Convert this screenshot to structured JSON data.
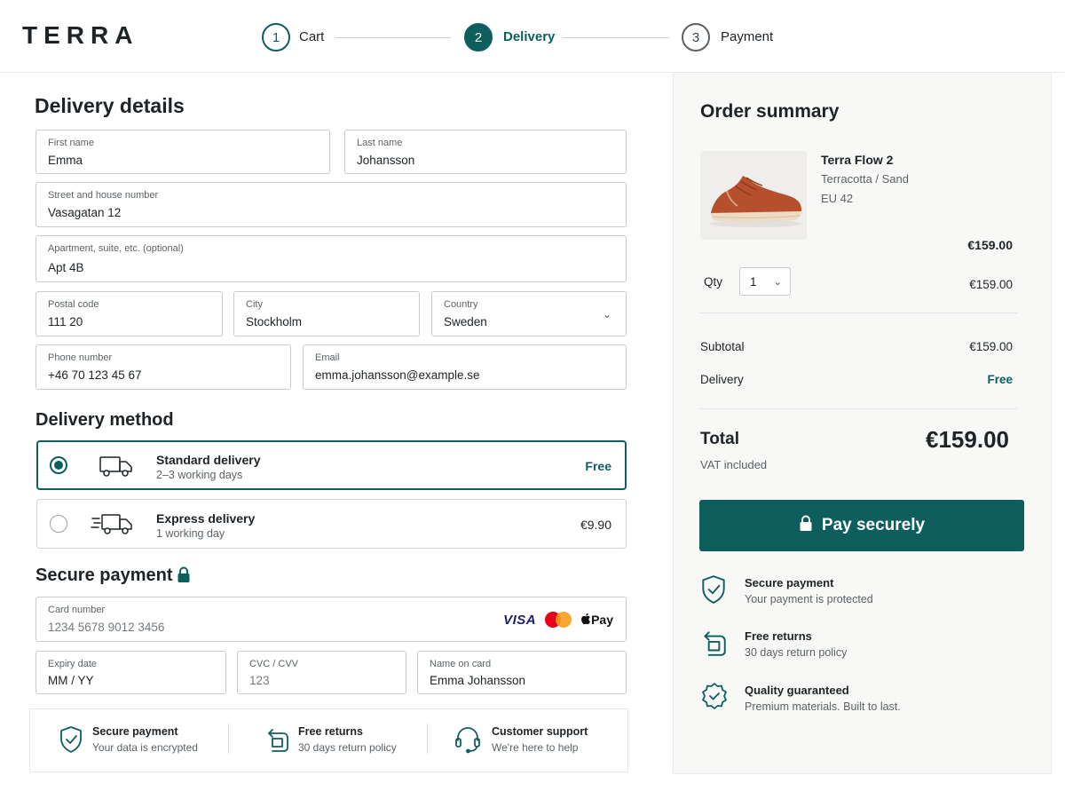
{
  "brand": {
    "logo": "TERRA"
  },
  "steps": [
    {
      "number": "1",
      "label": "Cart"
    },
    {
      "number": "2",
      "label": "Delivery"
    },
    {
      "number": "3",
      "label": "Payment"
    }
  ],
  "delivery_details": {
    "heading": "Delivery details",
    "fields": {
      "first_name": {
        "label": "First name",
        "value": "Emma"
      },
      "last_name": {
        "label": "Last name",
        "value": "Johansson"
      },
      "street": {
        "label": "Street and house number",
        "value": "Vasagatan 12"
      },
      "apartment": {
        "label": "Apartment, suite, etc. (optional)",
        "value": "Apt 4B"
      },
      "postal_code": {
        "label": "Postal code",
        "value": "111 20"
      },
      "city": {
        "label": "City",
        "value": "Stockholm"
      },
      "country": {
        "label": "Country",
        "value": "Sweden"
      },
      "phone": {
        "label": "Phone number",
        "value": "+46 70 123 45 67"
      },
      "email": {
        "label": "Email",
        "value": "emma.johansson@example.se"
      }
    }
  },
  "delivery_method": {
    "heading": "Delivery method",
    "options": [
      {
        "title": "Standard delivery",
        "subtitle": "2–3 working days",
        "price": "Free",
        "selected": true
      },
      {
        "title": "Express delivery",
        "subtitle": "1 working day",
        "price": "€9.90",
        "selected": false
      }
    ]
  },
  "secure_payment": {
    "heading": "Secure payment",
    "card_number": {
      "label": "Card number",
      "placeholder": "1234 5678 9012 3456"
    },
    "card_brands": {
      "visa": "VISA",
      "apple_pay": "Pay"
    },
    "expiry": {
      "label": "Expiry date",
      "placeholder": "MM / YY"
    },
    "cvc": {
      "label": "CVC / CVV",
      "placeholder": "123"
    },
    "name_on_card": {
      "label": "Name on card",
      "value": "Emma Johansson"
    }
  },
  "trust_bar": [
    {
      "icon": "shield-check-icon",
      "title": "Secure payment",
      "subtitle": "Your data is encrypted"
    },
    {
      "icon": "return-box-icon",
      "title": "Free returns",
      "subtitle": "30 days return policy"
    },
    {
      "icon": "headset-icon",
      "title": "Customer support",
      "subtitle": "We're here to help"
    }
  ],
  "order_summary": {
    "heading": "Order summary",
    "product": {
      "name": "Terra Flow 2",
      "variant": "Terracotta / Sand",
      "size": "EU 42",
      "price": "€159.00"
    },
    "qty_label": "Qty",
    "qty_value": "1",
    "qty_line_price": "€159.00",
    "subtotal_label": "Subtotal",
    "subtotal_value": "€159.00",
    "delivery_label": "Delivery",
    "delivery_value": "Free",
    "total_label": "Total",
    "total_value": "€159.00",
    "vat_note": "VAT included",
    "pay_button": "Pay securely",
    "assurances": [
      {
        "icon": "shield-check-icon",
        "title": "Secure payment",
        "subtitle": "Your payment is protected"
      },
      {
        "icon": "return-box-icon",
        "title": "Free returns",
        "subtitle": "30 days return policy"
      },
      {
        "icon": "quality-badge-icon",
        "title": "Quality guaranteed",
        "subtitle": "Premium materials. Built to last."
      }
    ]
  },
  "colors": {
    "accent": "#0f5e5e",
    "text": "#1d2327",
    "muted": "#5c6367",
    "summary_bg": "#f8f8f7",
    "shoe": "#b6502c"
  }
}
